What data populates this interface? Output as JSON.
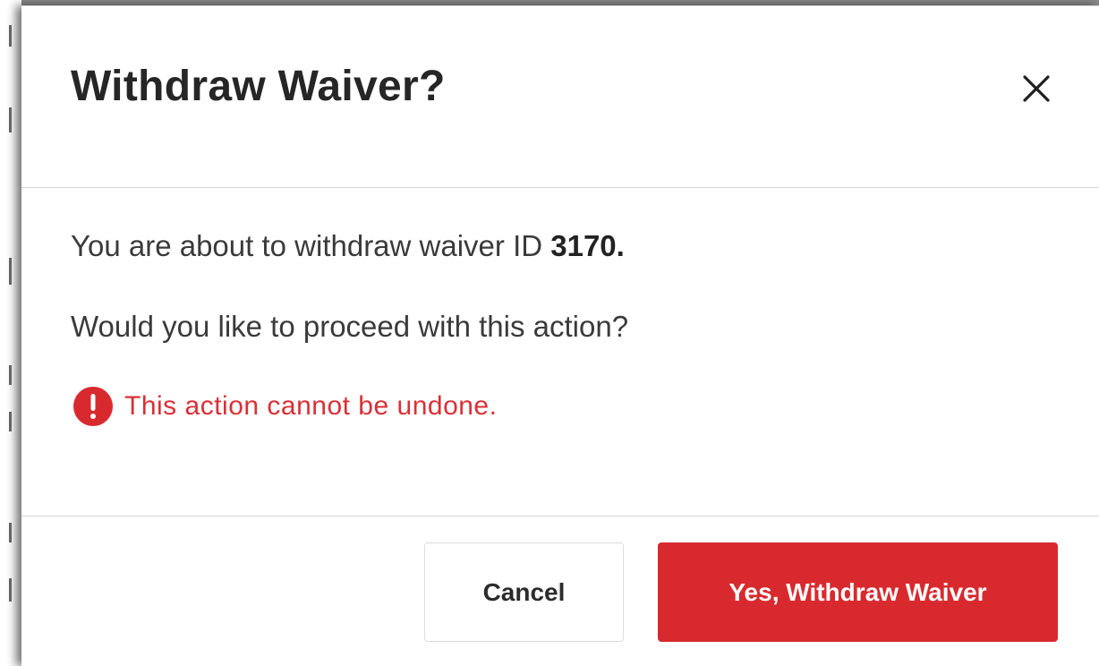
{
  "dialog": {
    "title": "Withdraw Waiver?",
    "close_icon": "close-icon",
    "message_prefix": "You are about to withdraw waiver ID ",
    "waiver_id": "3170.",
    "question": "Would you like to proceed with this action?",
    "warning_icon": "exclamation-circle-icon",
    "warning_text": "This action cannot be undone.",
    "cancel_label": "Cancel",
    "confirm_label": "Yes, Withdraw Waiver"
  },
  "colors": {
    "danger": "#d82a2e",
    "warning_text": "#d93036",
    "title_text": "#262626",
    "body_text": "#3a3a3a"
  }
}
